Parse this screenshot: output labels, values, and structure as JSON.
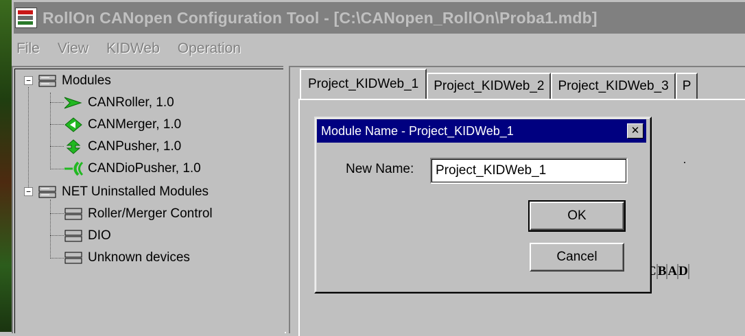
{
  "window": {
    "title": "RollOn CANopen Configuration Tool - [C:\\CANopen_RollOn\\Proba1.mdb]"
  },
  "menubar": {
    "items": [
      "File",
      "View",
      "KIDWeb",
      "Operation"
    ]
  },
  "tree": {
    "groups": [
      {
        "label": "Modules",
        "expander": "−",
        "children": [
          "CANRoller, 1.0",
          "CANMerger, 1.0",
          "CANPusher, 1.0",
          "CANDioPusher, 1.0"
        ]
      },
      {
        "label": "NET Uninstalled Modules",
        "expander": "−",
        "children": [
          "Roller/Merger Control",
          "DIO",
          "Unknown devices"
        ]
      }
    ]
  },
  "tabs": [
    {
      "label": "Project_KIDWeb_1",
      "active": true
    },
    {
      "label": "Project_KIDWeb_2",
      "active": false
    },
    {
      "label": "Project_KIDWeb_3",
      "active": false
    },
    {
      "label": "P",
      "active": false
    }
  ],
  "canvas_strip": {
    "cells": [
      "C",
      "B",
      "A",
      "D"
    ]
  },
  "dialog": {
    "title": "Module Name - Project_KIDWeb_1",
    "close_symbol": "✕",
    "name_label": "New Name:",
    "name_value": "Project_KIDWeb_1",
    "ok_label": "OK",
    "cancel_label": "Cancel"
  },
  "colors": {
    "titlebar_inactive": "#808080",
    "dialog_titlebar": "#000080",
    "face": "#c0c0c0",
    "icon_green": "#22b822"
  }
}
